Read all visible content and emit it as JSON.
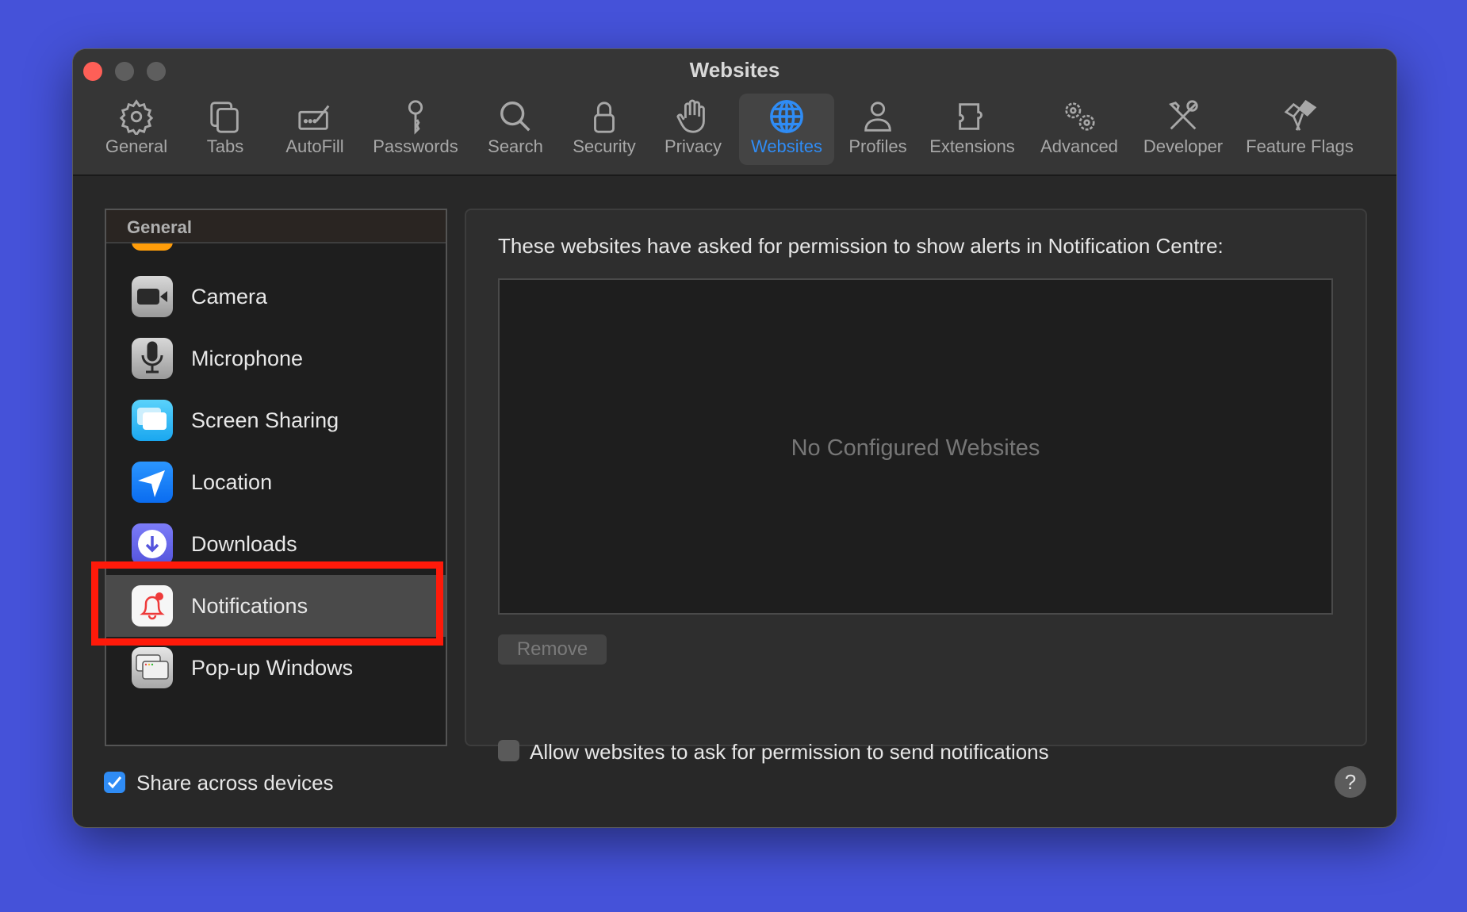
{
  "window": {
    "title": "Websites"
  },
  "toolbar": {
    "tabs": [
      {
        "label": "General",
        "icon": "gear-icon"
      },
      {
        "label": "Tabs",
        "icon": "tabs-icon"
      },
      {
        "label": "AutoFill",
        "icon": "autofill-icon"
      },
      {
        "label": "Passwords",
        "icon": "key-icon"
      },
      {
        "label": "Search",
        "icon": "search-icon"
      },
      {
        "label": "Security",
        "icon": "lock-icon"
      },
      {
        "label": "Privacy",
        "icon": "hand-icon"
      },
      {
        "label": "Websites",
        "icon": "globe-icon",
        "selected": true
      },
      {
        "label": "Profiles",
        "icon": "person-icon"
      },
      {
        "label": "Extensions",
        "icon": "puzzle-icon"
      },
      {
        "label": "Advanced",
        "icon": "gears-icon"
      },
      {
        "label": "Developer",
        "icon": "tools-icon"
      },
      {
        "label": "Feature Flags",
        "icon": "flags-icon"
      }
    ]
  },
  "sidebar": {
    "section_header": "General",
    "items": [
      {
        "label": "Camera",
        "icon": "camera-icon"
      },
      {
        "label": "Microphone",
        "icon": "microphone-icon"
      },
      {
        "label": "Screen Sharing",
        "icon": "screen-sharing-icon"
      },
      {
        "label": "Location",
        "icon": "location-icon"
      },
      {
        "label": "Downloads",
        "icon": "downloads-icon"
      },
      {
        "label": "Notifications",
        "icon": "bell-icon",
        "selected": true
      },
      {
        "label": "Pop-up Windows",
        "icon": "popup-windows-icon"
      }
    ]
  },
  "main": {
    "heading": "These websites have asked for permission to show alerts in Notification Centre:",
    "empty_text": "No Configured Websites",
    "remove_label": "Remove",
    "allow_label": "Allow websites to ask for permission to send notifications",
    "allow_checked": false
  },
  "footer": {
    "share_label": "Share across devices",
    "share_checked": true,
    "help_label": "?"
  },
  "colors": {
    "accent": "#2f8cf5",
    "highlight": "#ff1a0a",
    "desktop": "#4552d9"
  }
}
